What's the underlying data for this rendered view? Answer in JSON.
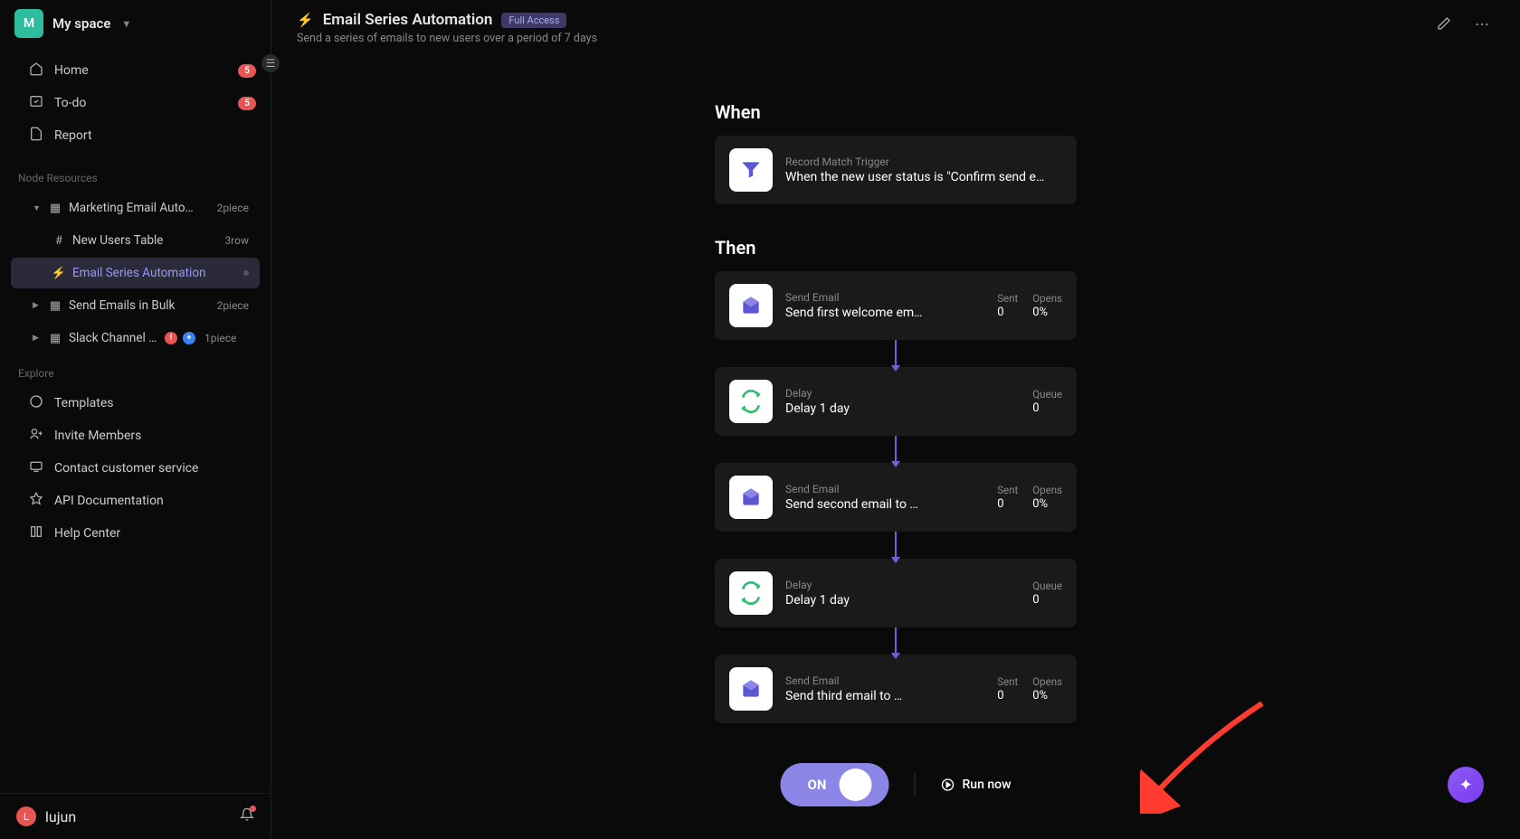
{
  "workspace": {
    "initial": "M",
    "name": "My space"
  },
  "nav": {
    "home": {
      "label": "Home",
      "badge": "5"
    },
    "todo": {
      "label": "To-do",
      "badge": "5"
    },
    "report": {
      "label": "Report"
    }
  },
  "sections": {
    "resources": "Node Resources",
    "explore": "Explore"
  },
  "tree": {
    "marketing": {
      "label": "Marketing Email Automa…",
      "meta": "2piece"
    },
    "users_table": {
      "label": "New Users Table",
      "meta": "3row"
    },
    "email_series": {
      "label": "Email Series Automation"
    },
    "bulk": {
      "label": "Send Emails in Bulk",
      "meta": "2piece"
    },
    "slack": {
      "label": "Slack Channel S…",
      "meta": "1piece"
    }
  },
  "explore": {
    "templates": "Templates",
    "invite": "Invite Members",
    "contact": "Contact customer service",
    "api": "API Documentation",
    "help": "Help Center"
  },
  "user": {
    "initial": "L",
    "name": "lujun"
  },
  "header": {
    "title": "Email Series Automation",
    "access": "Full Access",
    "subtitle": "Send a series of emails to new users over a period of 7 days"
  },
  "when": {
    "label": "When",
    "trigger": {
      "type": "Record Match Trigger",
      "desc": "When the new user status is \"Confirm send e…"
    }
  },
  "then": {
    "label": "Then",
    "steps": [
      {
        "type": "Send Email",
        "desc": "Send first welcome em…",
        "stats": [
          [
            "Sent",
            "0"
          ],
          [
            "Opens",
            "0%"
          ]
        ]
      },
      {
        "type": "Delay",
        "desc": "Delay 1 day",
        "stats": [
          [
            "Queue",
            "0"
          ]
        ]
      },
      {
        "type": "Send Email",
        "desc": "Send second email to …",
        "stats": [
          [
            "Sent",
            "0"
          ],
          [
            "Opens",
            "0%"
          ]
        ]
      },
      {
        "type": "Delay",
        "desc": "Delay 1 day",
        "stats": [
          [
            "Queue",
            "0"
          ]
        ]
      },
      {
        "type": "Send Email",
        "desc": "Send third email to …",
        "stats": [
          [
            "Sent",
            "0"
          ],
          [
            "Opens",
            "0%"
          ]
        ]
      }
    ]
  },
  "footer": {
    "toggle": "ON",
    "run": "Run now"
  }
}
